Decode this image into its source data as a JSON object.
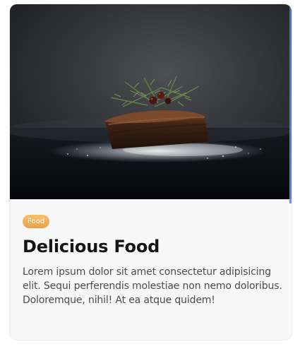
{
  "card": {
    "image_alt": "cake-image",
    "tag": "Food",
    "title": "Delicious Food",
    "description": "Lorem ipsum dolor sit amet consectetur adipisicing elit. Sequi perferendis molestiae non nemo doloribus. Doloremque, nihil! At ea atque quidem!",
    "accent_color": "#ec9f45"
  }
}
